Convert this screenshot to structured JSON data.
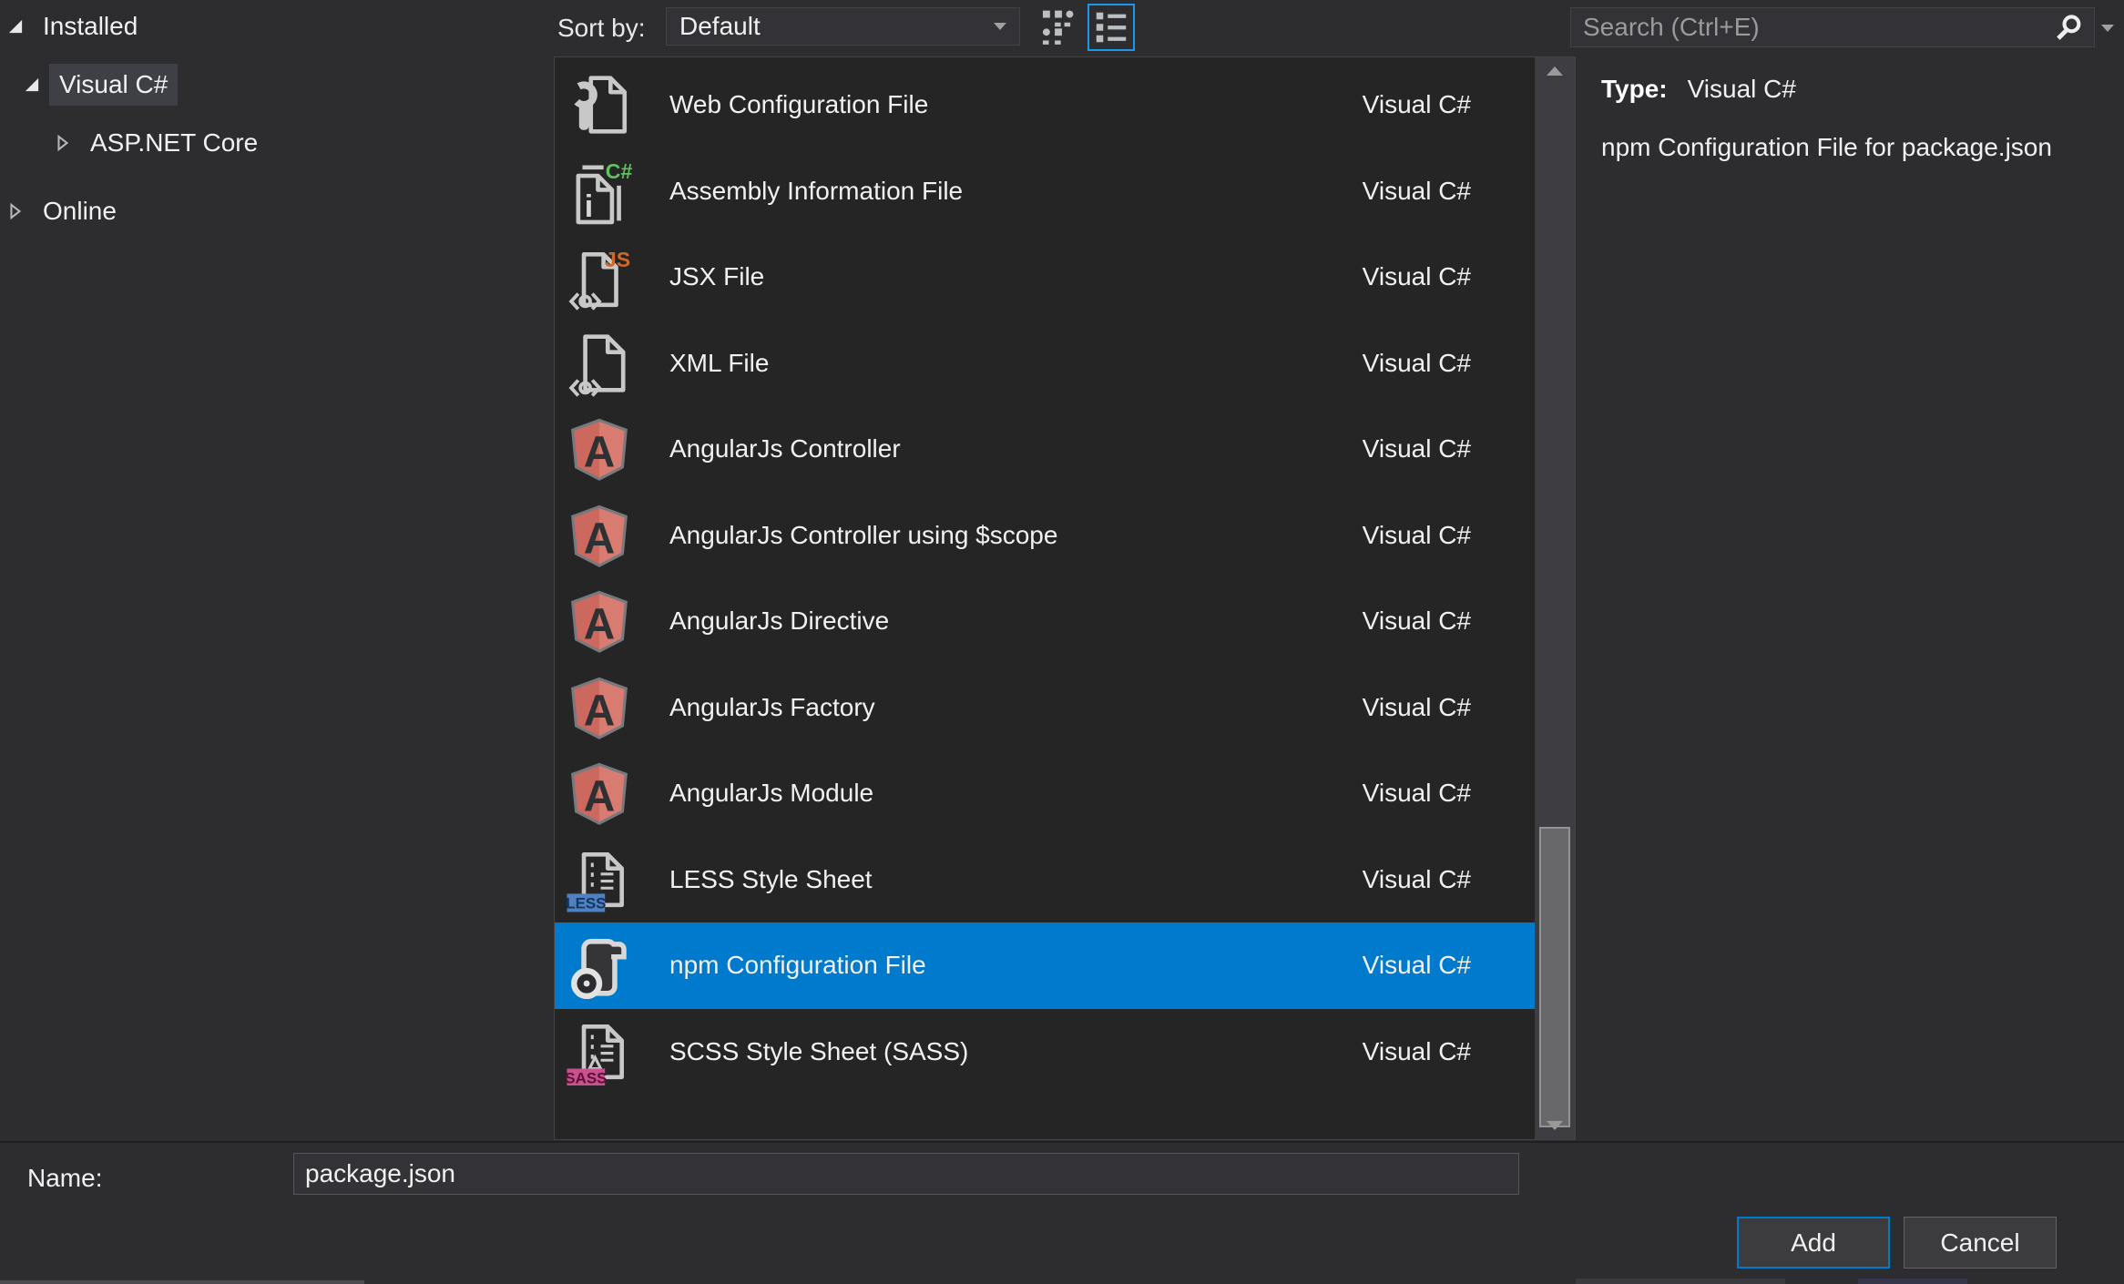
{
  "accent_color": "#007acc",
  "tree": {
    "selected_index": 1,
    "items": [
      {
        "label": "Installed",
        "state": "expanded"
      },
      {
        "label": "Visual C#",
        "state": "expanded"
      },
      {
        "label": "ASP.NET Core",
        "state": "collapsed"
      },
      {
        "label": "Online",
        "state": "collapsed"
      }
    ]
  },
  "toolbar": {
    "sort_label": "Sort by:",
    "sort_value": "Default"
  },
  "search": {
    "placeholder": "Search (Ctrl+E)"
  },
  "list": {
    "selected_index": 10,
    "items": [
      {
        "label": "Web Configuration File",
        "category": "Visual C#",
        "icon": "web-configuration-file-icon"
      },
      {
        "label": "Assembly Information File",
        "category": "Visual C#",
        "icon": "assembly-information-file-icon",
        "badge": "C#",
        "badge2": "i"
      },
      {
        "label": "JSX File",
        "category": "Visual C#",
        "icon": "jsx-file-icon",
        "badge": "JS"
      },
      {
        "label": "XML File",
        "category": "Visual C#",
        "icon": "xml-file-icon"
      },
      {
        "label": "AngularJs Controller",
        "category": "Visual C#",
        "icon": "angularjs-shield-icon",
        "badge": "A"
      },
      {
        "label": "AngularJs Controller using $scope",
        "category": "Visual C#",
        "icon": "angularjs-shield-icon",
        "badge": "A"
      },
      {
        "label": "AngularJs Directive",
        "category": "Visual C#",
        "icon": "angularjs-shield-icon",
        "badge": "A"
      },
      {
        "label": "AngularJs Factory",
        "category": "Visual C#",
        "icon": "angularjs-shield-icon",
        "badge": "A"
      },
      {
        "label": "AngularJs Module",
        "category": "Visual C#",
        "icon": "angularjs-shield-icon",
        "badge": "A"
      },
      {
        "label": "LESS Style Sheet",
        "category": "Visual C#",
        "icon": "less-stylesheet-icon",
        "badge": "LESS"
      },
      {
        "label": "npm Configuration File",
        "category": "Visual C#",
        "icon": "npm-configuration-file-icon"
      },
      {
        "label": "SCSS Style Sheet (SASS)",
        "category": "Visual C#",
        "icon": "scss-stylesheet-icon",
        "badge": "SASS"
      }
    ]
  },
  "details": {
    "type_label": "Type:",
    "type_value": "Visual C#",
    "description": "npm Configuration File for package.json"
  },
  "name_field": {
    "label": "Name:",
    "value": "package.json"
  },
  "buttons": {
    "add": "Add",
    "cancel": "Cancel"
  }
}
